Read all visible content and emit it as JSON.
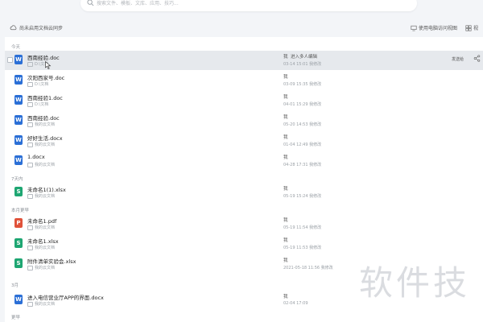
{
  "search": {
    "placeholder": "搜索文件、模板、文库、应用、技巧..."
  },
  "header": {
    "sync_label": "尚未启用文档云同步",
    "right_links": [
      "使用电脑访问视图",
      "视"
    ]
  },
  "groups": [
    {
      "label": "今天"
    },
    {
      "label": "7天内"
    },
    {
      "label": "本月更早"
    },
    {
      "label": "3月"
    },
    {
      "label": "更早"
    }
  ],
  "files": [
    {
      "name": "西南经验.doc",
      "location": "D:\\文档",
      "sharer": "我",
      "sharer_note": "进入多人编辑",
      "date": "03-14 15:01",
      "time_note": "我修改",
      "highlighted": true,
      "tag": "发送给",
      "type": "word"
    },
    {
      "name": "次阳西家号.doc",
      "location": "D:\\文档",
      "sharer": "我",
      "sharer_note": "",
      "date": "03-09 15:35",
      "time_note": "我修改",
      "highlighted": false,
      "type": "word"
    },
    {
      "name": "西南经验1.doc",
      "location": "D:\\文档",
      "sharer": "我",
      "sharer_note": "",
      "date": "04-01 15:29",
      "time_note": "我修改",
      "highlighted": false,
      "type": "word"
    },
    {
      "name": "西南经验.doc",
      "location": "我的云文档",
      "sharer": "我",
      "sharer_note": "",
      "date": "05-20 14:53",
      "time_note": "我修改",
      "highlighted": false,
      "type": "word"
    },
    {
      "name": "好好生活.docx",
      "location": "我的云文档",
      "sharer": "我",
      "sharer_note": "",
      "date": "01-04 12:49",
      "time_note": "我修改",
      "highlighted": false,
      "type": "word"
    },
    {
      "name": "1.docx",
      "location": "我的云文档",
      "sharer": "我",
      "sharer_note": "",
      "date": "04-28 17:31",
      "time_note": "我修改",
      "highlighted": false,
      "type": "word"
    },
    {
      "name": "未命名1(1).xlsx",
      "location": "我的云文档",
      "sharer": "我",
      "sharer_note": "",
      "date": "05-19 15:24",
      "time_note": "我修改",
      "highlighted": false,
      "type": "excel"
    },
    {
      "name": "未命名1.pdf",
      "location": "我的云文档",
      "sharer": "我",
      "sharer_note": "",
      "date": "05-19 11:54",
      "time_note": "我修改",
      "highlighted": false,
      "type": "pdf"
    },
    {
      "name": "未命名1.xlsx",
      "location": "我的云文档",
      "sharer": "我",
      "sharer_note": "",
      "date": "05-19 11:53",
      "time_note": "我修改",
      "highlighted": false,
      "type": "excel"
    },
    {
      "name": "附件清单实验会.xlsx",
      "location": "我的云文档",
      "sharer": "我",
      "sharer_note": "",
      "date": "2021-05-18 11:56",
      "time_note": "我修改",
      "highlighted": false,
      "type": "excel"
    },
    {
      "name": "进入电信营业厅APP的界面.docx",
      "location": "我的云文档",
      "sharer": "我",
      "sharer_note": "",
      "date": "02-04 17:09",
      "time_note": "",
      "highlighted": false,
      "type": "word"
    }
  ],
  "icon_letters": {
    "word": "W",
    "excel": "S",
    "pdf": "P"
  },
  "watermark": "软件技",
  "colors": {
    "word": "#2b6fd6",
    "excel": "#1ea672",
    "pdf": "#e0523a",
    "highlight": "#e6e9ed"
  }
}
